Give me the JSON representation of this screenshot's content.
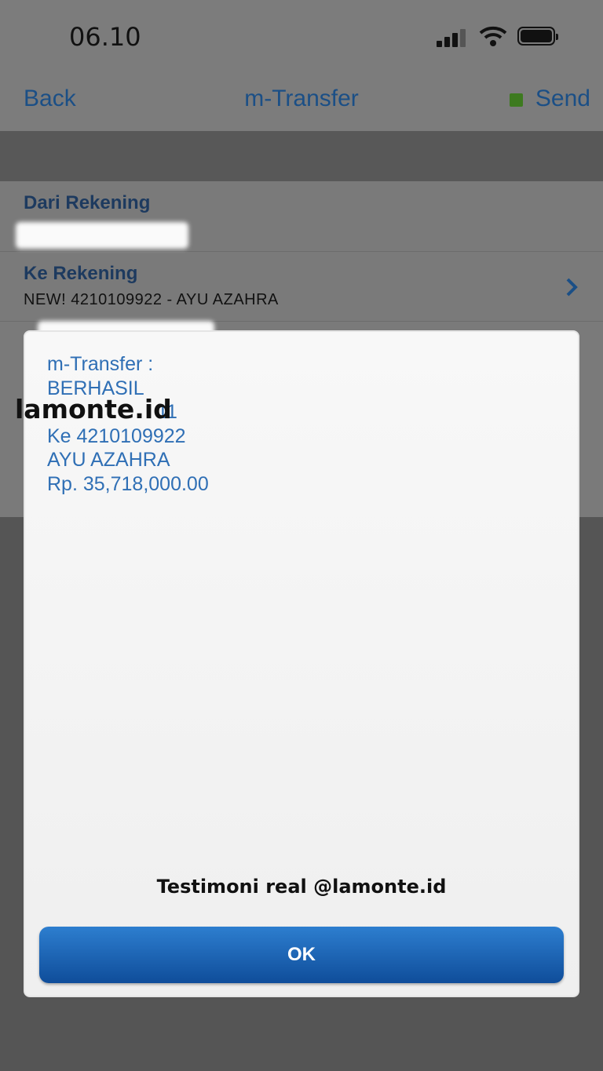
{
  "status_bar": {
    "time": "06.10"
  },
  "nav": {
    "back": "Back",
    "title": "m-Transfer",
    "send": "Send"
  },
  "form": {
    "from": {
      "label": "Dari Rekening"
    },
    "to": {
      "label": "Ke Rekening",
      "value": "NEW! 4210109922 - AYU AZAHRA"
    }
  },
  "modal": {
    "lines": [
      "m-Transfer :",
      "BERHASIL",
      "",
      "Ke 4210109922",
      "AYU AZAHRA",
      "Rp. 35,718,000.00"
    ],
    "partial_line_suffix": "11",
    "ok_label": "OK"
  },
  "watermark": {
    "logo": "lamonte.id",
    "caption": "Testimoni real @lamonte.id"
  },
  "colors": {
    "link": "#1b4f86",
    "accent_dot": "#3d7a1f",
    "message": "#2f6fb5",
    "button": "#1d64b6"
  }
}
